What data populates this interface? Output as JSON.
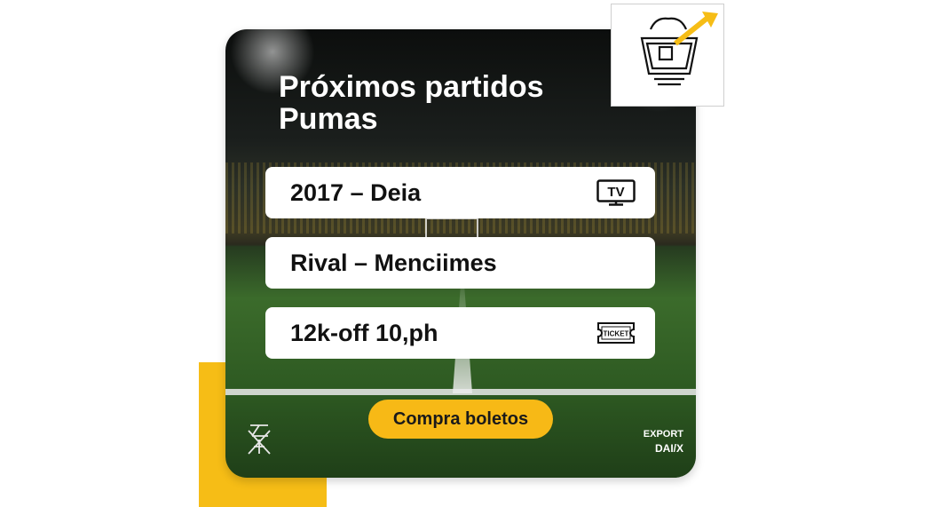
{
  "card": {
    "title_line1": "Próximos partidos",
    "title_line2": "Pumas",
    "rows": [
      {
        "text": "2017 – Deia",
        "icon": "tv-icon",
        "icon_text": "TV"
      },
      {
        "text": "Rival – Menciimes"
      },
      {
        "text": "12k-off 10,ph",
        "icon": "ticket-icon",
        "icon_text": "TICKET"
      }
    ],
    "cta_label": "Compra boletos",
    "footer_line1": "EXPORT",
    "footer_line2": "DAI/X"
  },
  "colors": {
    "accent": "#f6bd16",
    "row_bg": "#ffffff",
    "text_dark": "#111111"
  }
}
